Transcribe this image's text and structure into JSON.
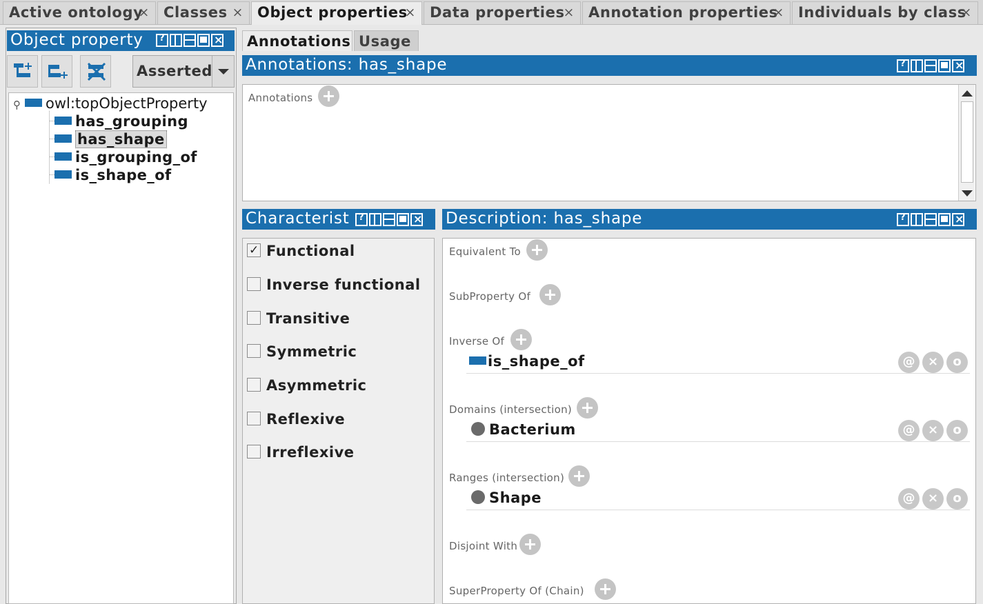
{
  "top_tabs": [
    {
      "label": "Active ontology",
      "close": "×"
    },
    {
      "label": "Classes",
      "close": "×"
    },
    {
      "label": "Object properties",
      "close": "×"
    },
    {
      "label": "Data properties",
      "close": "×"
    },
    {
      "label": "Annotation properties",
      "close": "×"
    },
    {
      "label": "Individuals by class",
      "close": "×"
    }
  ],
  "left_panel": {
    "title": "Object property",
    "hierarchy_mode": "Asserted",
    "tree": {
      "root": "owl:topObjectProperty",
      "children": [
        "has_grouping",
        "has_shape",
        "is_grouping_of",
        "is_shape_of"
      ],
      "selected": "has_shape"
    }
  },
  "sub_tabs": [
    "Annotations",
    "Usage"
  ],
  "annotations_panel": {
    "title": "Annotations: has_shape",
    "section_label": "Annotations"
  },
  "characteristics_panel": {
    "title": "Characterist",
    "items": [
      {
        "label": "Functional",
        "checked": true
      },
      {
        "label": "Inverse functional",
        "checked": false
      },
      {
        "label": "Transitive",
        "checked": false
      },
      {
        "label": "Symmetric",
        "checked": false
      },
      {
        "label": "Asymmetric",
        "checked": false
      },
      {
        "label": "Reflexive",
        "checked": false
      },
      {
        "label": "Irreflexive",
        "checked": false
      }
    ]
  },
  "description_panel": {
    "title": "Description: has_shape",
    "sections": {
      "equivalent_to": "Equivalent To",
      "subproperty_of": "SubProperty Of",
      "inverse_of": "Inverse Of",
      "domains": "Domains (intersection)",
      "ranges": "Ranges (intersection)",
      "disjoint_with": "Disjoint With",
      "superproperty_chain": "SuperProperty Of (Chain)"
    },
    "entries": {
      "inverse_of": "is_shape_of",
      "domain": "Bacterium",
      "range": "Shape"
    },
    "entry_actions": [
      "@",
      "×",
      "o"
    ]
  },
  "colors": {
    "title_bar": "#1b6fae",
    "property_icon": "#1b6fae",
    "class_icon": "#6a6a6a"
  }
}
